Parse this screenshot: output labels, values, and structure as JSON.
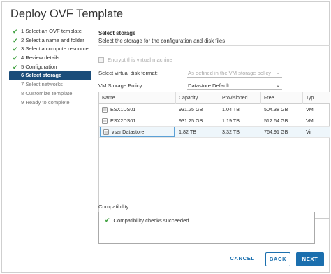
{
  "window": {
    "title": "Deploy OVF Template"
  },
  "steps": [
    {
      "label": "1 Select an OVF template",
      "state": "done"
    },
    {
      "label": "2 Select a name and folder",
      "state": "done"
    },
    {
      "label": "3 Select a compute resource",
      "state": "done"
    },
    {
      "label": "4 Review details",
      "state": "done"
    },
    {
      "label": "5 Configuration",
      "state": "done"
    },
    {
      "label": "6 Select storage",
      "state": "active"
    },
    {
      "label": "7 Select networks",
      "state": "pending"
    },
    {
      "label": "8 Customize template",
      "state": "pending"
    },
    {
      "label": "9 Ready to complete",
      "state": "pending"
    }
  ],
  "storage": {
    "title": "Select storage",
    "description": "Select the storage for the configuration and disk files",
    "encrypt_label": "Encrypt this virtual machine",
    "disk_format_label": "Select virtual disk format:",
    "disk_format_value": "As defined in the VM storage policy",
    "policy_label": "VM Storage Policy:",
    "policy_value": "Datastore Default"
  },
  "table": {
    "columns": [
      "Name",
      "Capacity",
      "Provisioned",
      "Free",
      "Typ"
    ],
    "rows": [
      {
        "name": "ESX1DS01",
        "capacity": "931.25 GB",
        "provisioned": "1.04 TB",
        "free": "504.38 GB",
        "type": "VM"
      },
      {
        "name": "ESX2DS01",
        "capacity": "931.25 GB",
        "provisioned": "1.19 TB",
        "free": "512.64 GB",
        "type": "VM"
      },
      {
        "name": "vsanDatastore",
        "capacity": "1.82 TB",
        "provisioned": "3.32 TB",
        "free": "764.91 GB",
        "type": "Vir"
      }
    ]
  },
  "compatibility": {
    "label": "Compatibility",
    "message": "Compatibility checks succeeded."
  },
  "buttons": {
    "cancel": "CANCEL",
    "back": "BACK",
    "next": "NEXT"
  },
  "icons": {
    "done": "check-icon",
    "datastore": "datastore-icon",
    "dropdown": "chevron-down-icon"
  },
  "colors": {
    "accent": "#1b6fae",
    "active_step": "#1b4d7a",
    "success": "#3c9f3c"
  }
}
